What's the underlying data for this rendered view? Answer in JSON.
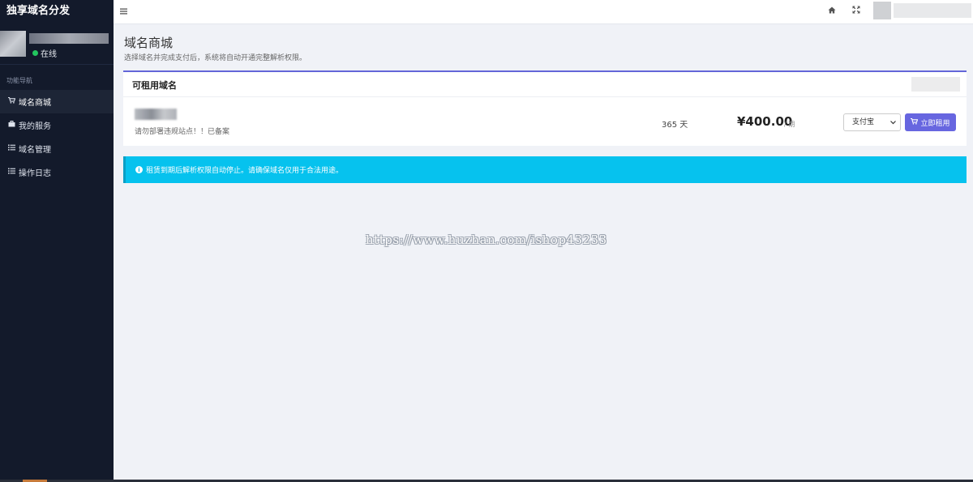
{
  "app": {
    "brand": "独享域名分发"
  },
  "sidebar": {
    "status": "在线",
    "nav_header": "功能导航",
    "items": [
      {
        "label": "域名商城",
        "icon": "cart-icon",
        "active": true
      },
      {
        "label": "我的服务",
        "icon": "briefcase-icon",
        "active": false
      },
      {
        "label": "域名管理",
        "icon": "list-icon",
        "active": false
      },
      {
        "label": "操作日志",
        "icon": "list-icon",
        "active": false
      }
    ]
  },
  "topbar": {
    "icons": [
      "menu-icon",
      "home-icon",
      "expand-icon"
    ]
  },
  "page": {
    "title": "域名商城",
    "subtitle": "选择域名并完成支付后，系统将自动开通完整解析权限。"
  },
  "card": {
    "title": "可租用域名",
    "domain": {
      "note": "请勿部署违规站点！！已备案",
      "period": "365 天",
      "price": "¥400.00",
      "price_unit": "/ 期",
      "payment_selected": "支付宝",
      "rent_label": "立即租用"
    }
  },
  "alert": {
    "text": "租赁到期后解析权限自动停止。请确保域名仅用于合法用途。"
  },
  "watermark": "https://www.huzhan.com/ishop43233",
  "colors": {
    "sidebar_bg": "#131a2b",
    "accent": "#6766e0",
    "alert": "#06c2ee",
    "online": "#22c55e"
  }
}
